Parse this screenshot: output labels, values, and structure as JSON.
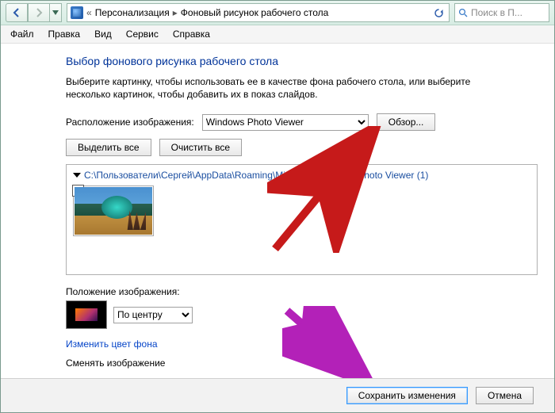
{
  "titlebar": {
    "crumb1": "Персонализация",
    "crumb2": "Фоновый рисунок рабочего стола",
    "search_placeholder": "Поиск в П..."
  },
  "menu": {
    "file": "Файл",
    "edit": "Правка",
    "view": "Вид",
    "service": "Сервис",
    "help": "Справка"
  },
  "content": {
    "heading": "Выбор фонового рисунка рабочего стола",
    "subtext": "Выберите картинку, чтобы использовать ее в качестве фона рабочего стола, или выберите несколько картинок, чтобы добавить их в показ слайдов.",
    "location_label": "Расположение изображения:",
    "location_option": "Windows Photo Viewer",
    "browse": "Обзор...",
    "select_all": "Выделить все",
    "clear_all": "Очистить все",
    "group_path": "C:\\Пользователи\\Сергей\\AppData\\Roaming\\Microsoft\\Windows Photo Viewer (1)",
    "position_label": "Положение изображения:",
    "position_option": "По центру",
    "change_color": "Изменить цвет фона",
    "change_image_text": "Сменять изображение"
  },
  "footer": {
    "save": "Сохранить изменения",
    "cancel": "Отмена"
  }
}
